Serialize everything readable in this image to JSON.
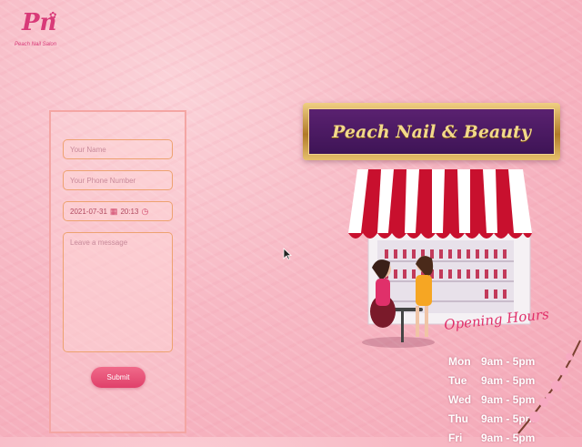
{
  "brand": {
    "logo_mark": "Pn",
    "logo_star": "✿",
    "logo_text": "Peach Nail Salon"
  },
  "form": {
    "name_placeholder": "Your Name",
    "phone_placeholder": "Your Phone Number",
    "date_value": "2021-07-31",
    "time_value": "20:13",
    "message_placeholder": "Leave a message",
    "submit_label": "Submit"
  },
  "sign": {
    "title": "Peach Nail & Beauty"
  },
  "hours": {
    "title": "Opening Hours",
    "rows": [
      {
        "day": "Mon",
        "time": "9am - 5pm"
      },
      {
        "day": "Tue",
        "time": "9am - 5pm"
      },
      {
        "day": "Wed",
        "time": "9am - 5pm"
      },
      {
        "day": "Thu",
        "time": "9am - 5pm"
      },
      {
        "day": "Fri",
        "time": "9am - 5pm"
      }
    ]
  },
  "colors": {
    "accent": "#e0406a",
    "sign_purple": "#4a1862",
    "sign_gold": "#e7c06c"
  },
  "icons": [
    "calendar-icon",
    "clock-icon",
    "cursor-icon"
  ]
}
